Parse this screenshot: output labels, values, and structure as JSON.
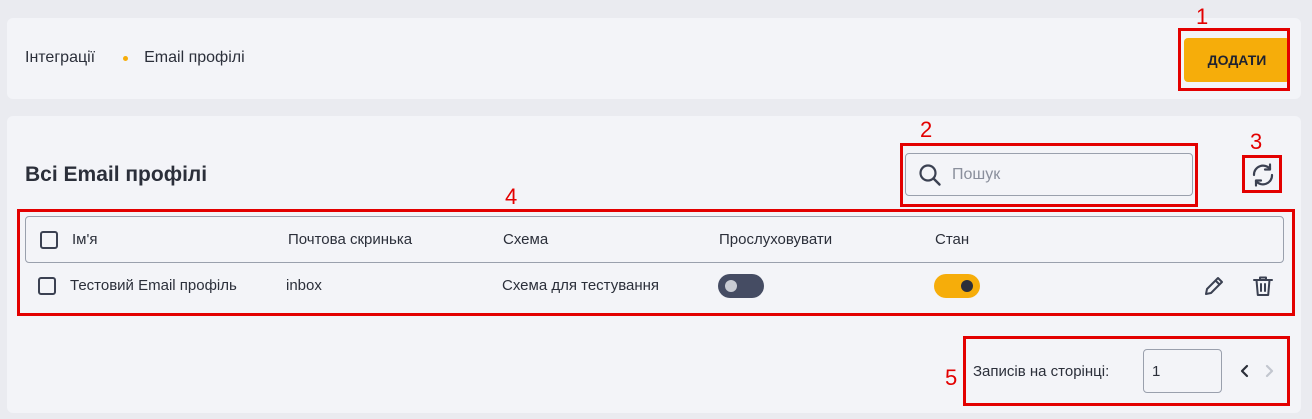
{
  "breadcrumb": {
    "items": [
      "Інтеграції",
      "Email профілі"
    ]
  },
  "header": {
    "add_button": "ДОДАТИ"
  },
  "main": {
    "title": "Всі Email профілі",
    "search": {
      "placeholder": "Пошук",
      "value": ""
    },
    "refresh_icon": "refresh-icon"
  },
  "table": {
    "columns": [
      "Ім'я",
      "Почтова скринька",
      "Схема",
      "Прослуховувати",
      "Стан"
    ],
    "rows": [
      {
        "name": "Тестовий Email профіль",
        "mailbox": "inbox",
        "scheme": "Схема для тестування",
        "listen": false,
        "state": true
      }
    ]
  },
  "pagination": {
    "label": "Записів на сторінці:",
    "value": "1"
  },
  "annotations": [
    "1",
    "2",
    "3",
    "4",
    "5"
  ],
  "colors": {
    "accent": "#f6ad0a",
    "toggle_off": "#454c63",
    "annotation": "#e30000"
  }
}
